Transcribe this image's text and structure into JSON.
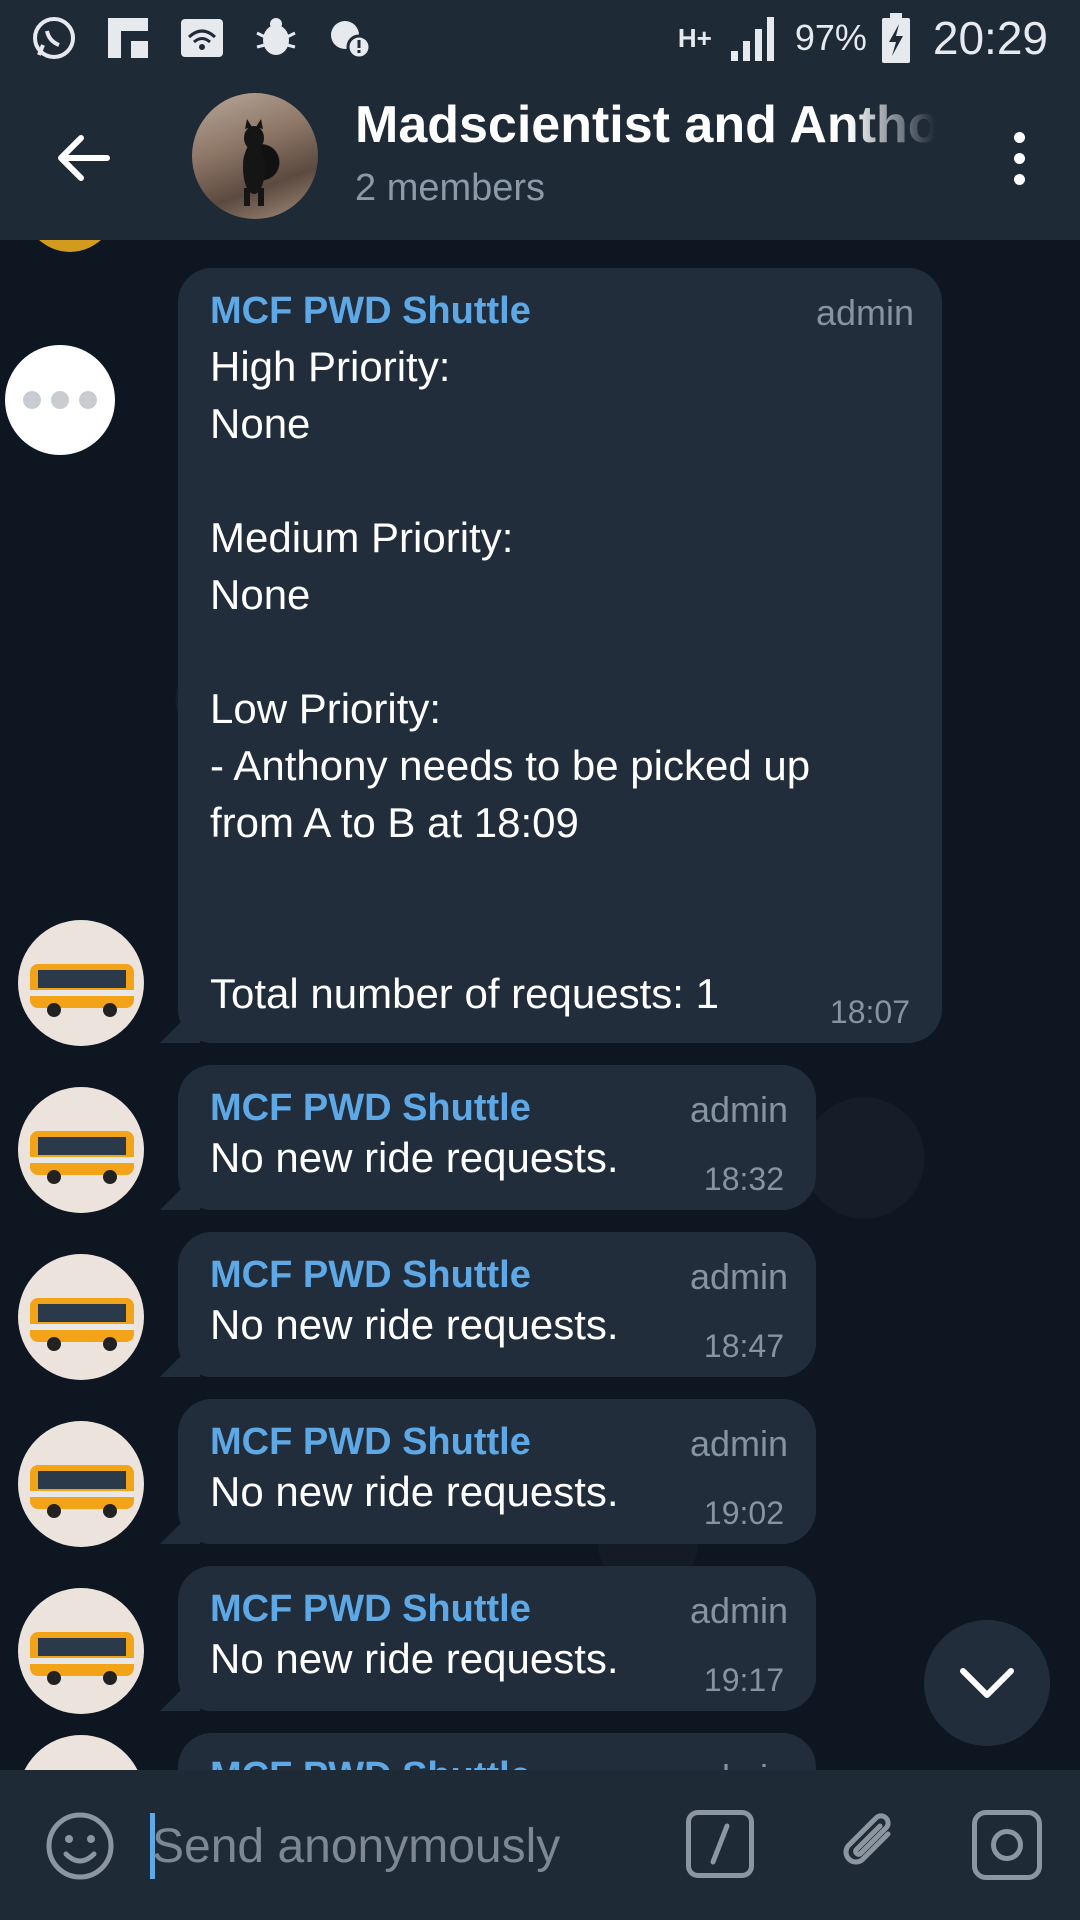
{
  "status_bar": {
    "network_type": "H+",
    "battery_percent": "97%",
    "time": "20:29",
    "icons": [
      "whatsapp-icon",
      "flipboard-icon",
      "wifi-calling-icon",
      "bug-icon",
      "location-alert-icon"
    ]
  },
  "header": {
    "title": "Madscientist and Anthony",
    "subtitle": "2 members"
  },
  "messages": [
    {
      "sender": "MCF PWD Shuttle",
      "role": "admin",
      "text": "High Priority:\nNone\n\nMedium Priority:\nNone\n\nLow Priority:\n- Anthony needs to be picked up\nfrom A to B at 18:09\n\n\nTotal number of requests: 1",
      "time": "18:07"
    },
    {
      "sender": "MCF PWD Shuttle",
      "role": "admin",
      "text": "No new ride requests.",
      "time": "18:32"
    },
    {
      "sender": "MCF PWD Shuttle",
      "role": "admin",
      "text": "No new ride requests.",
      "time": "18:47"
    },
    {
      "sender": "MCF PWD Shuttle",
      "role": "admin",
      "text": "No new ride requests.",
      "time": "19:02"
    },
    {
      "sender": "MCF PWD Shuttle",
      "role": "admin",
      "text": "No new ride requests.",
      "time": "19:17"
    },
    {
      "sender": "MCF PWD Shuttle",
      "role": "admin",
      "text": "",
      "time": ""
    }
  ],
  "input": {
    "placeholder": "Send anonymously"
  },
  "colors": {
    "header_bg": "#1f2a37",
    "chat_bg": "#0e1621",
    "bubble_bg": "#222d3b",
    "sender_name": "#5ea8e6",
    "muted_text": "#8693a1"
  }
}
